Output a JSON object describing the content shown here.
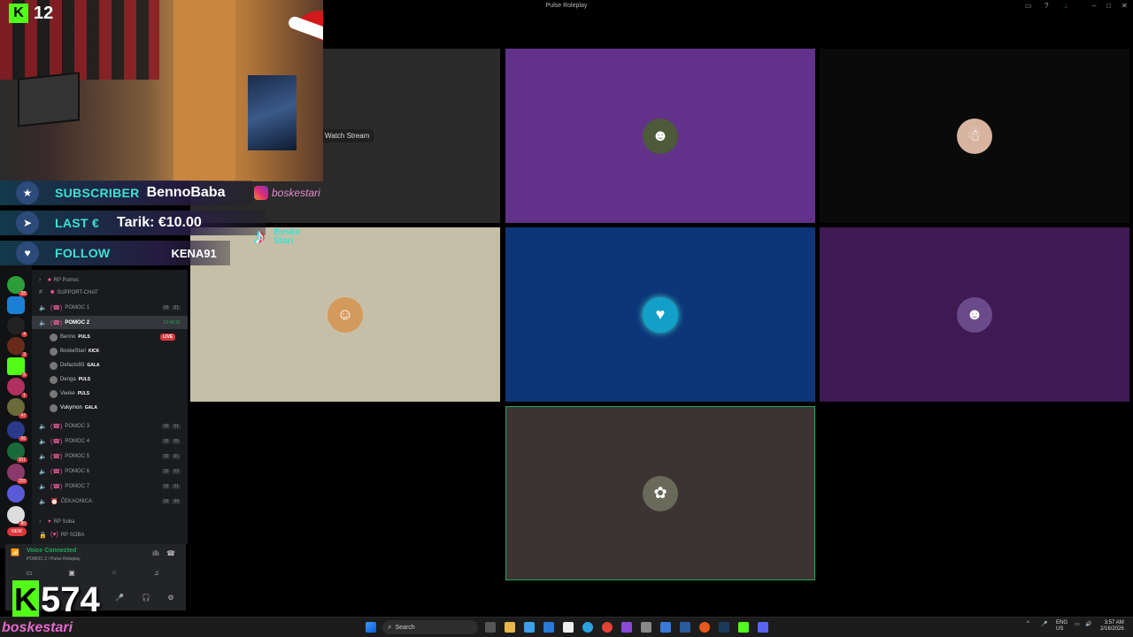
{
  "window": {
    "title": "Pulse Roleplay"
  },
  "stream_overlay": {
    "kick_viewers_top": "12",
    "alerts": [
      {
        "label": "SUBSCRIBER",
        "value": "BennoBaba"
      },
      {
        "label": "LAST €",
        "value": "Tarik: €10.00"
      },
      {
        "label": "FOLLOW",
        "value": "KENA91"
      }
    ],
    "instagram_handle": "boskestari",
    "tiktok_text_1": "Boske",
    "tiktok_text_2": "Stari",
    "kick_viewers_bottom": "574",
    "channel_handle": "boskestari"
  },
  "video_grid": {
    "watch_stream_tooltip": "Watch Stream",
    "tiles": [
      {
        "name": "tile-stream",
        "bg": "#2a2a2a",
        "avatar_icon": "",
        "avatar_bg": ""
      },
      {
        "name": "tile-purple",
        "bg": "#62328a",
        "avatar_icon": "goblin-icon",
        "avatar_bg": "#4c5a3a"
      },
      {
        "name": "tile-dark",
        "bg": "#0a0a0a",
        "avatar_icon": "santa-icon",
        "avatar_bg": "#d8b4a0"
      },
      {
        "name": "tile-beige",
        "bg": "#c6bfa8",
        "avatar_icon": "cartoon-icon",
        "avatar_bg": "#d39a5b"
      },
      {
        "name": "tile-blue",
        "bg": "#0d3579",
        "avatar_icon": "heartbeat-icon",
        "avatar_bg": "#12a0c8"
      },
      {
        "name": "tile-violet",
        "bg": "#3f1a52",
        "avatar_icon": "person-icon",
        "avatar_bg": "#6a4a8a"
      },
      {
        "name": "tile-brown",
        "bg": "#3c3433",
        "avatar_icon": "group-icon",
        "avatar_bg": "#6a6a5a"
      }
    ]
  },
  "discord": {
    "category_pomoc": "RP Pomoc",
    "support_chat": "SUPPORT-CHAT",
    "channels_top": [
      {
        "name": "POMOC 1",
        "c1": "00",
        "c2": "01"
      },
      {
        "name": "POMOC 2",
        "time": "12:46:21"
      }
    ],
    "users": [
      {
        "name": "Benno",
        "tag": "PULS"
      },
      {
        "name": "BoskeStari",
        "tag": "KICK"
      },
      {
        "name": "Defacto93",
        "tag": "GALA"
      },
      {
        "name": "Denga",
        "tag": "PULS"
      },
      {
        "name": "Veeke",
        "tag": "PULS"
      },
      {
        "name": "Vukymon",
        "tag": "GALA"
      }
    ],
    "live_badge": "LIVE",
    "channels_bottom": [
      {
        "name": "POMOC 3",
        "c1": "00",
        "c2": "01"
      },
      {
        "name": "POMOC 4",
        "c1": "00",
        "c2": "05"
      },
      {
        "name": "POMOC 5",
        "c1": "00",
        "c2": "01"
      },
      {
        "name": "POMOC 6",
        "c1": "00",
        "c2": "03"
      },
      {
        "name": "POMOC 7",
        "c1": "00",
        "c2": "01"
      },
      {
        "name": "ČEKAONICA",
        "c1": "00",
        "c2": "99"
      }
    ],
    "category_soba": "RP Soba",
    "rp_soba": "RP SOBA",
    "voice_connected": "Voice Connected",
    "voice_sub": "POMOC 2 / Pulse Roleplay",
    "server_badges": [
      "28",
      "4",
      "3",
      "6",
      "1",
      "47",
      "66",
      "101",
      "155",
      "80",
      "NEW"
    ]
  },
  "taskbar": {
    "search_placeholder": "Search",
    "lang_1": "ENG",
    "lang_2": "US",
    "time": "3:57 AM",
    "date": "2/16/2026"
  },
  "colors": {
    "kick_green": "#53fc18",
    "discord_green": "#23a55a",
    "accent_teal": "#3fe0d0"
  }
}
